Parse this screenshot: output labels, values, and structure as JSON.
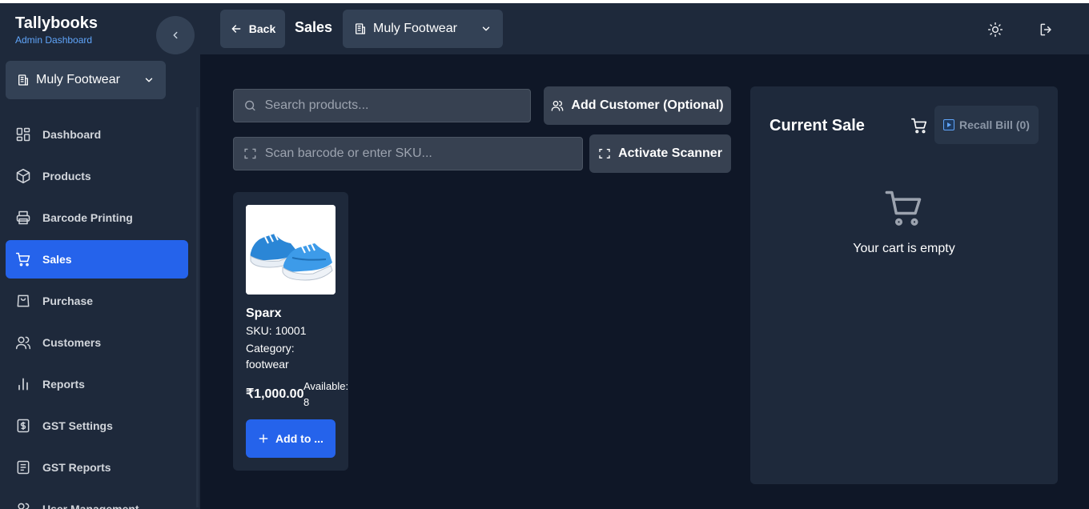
{
  "app": {
    "title": "Tallybooks",
    "subtitle": "Admin Dashboard"
  },
  "sidebar": {
    "store_selector": {
      "value": "Muly Footwear"
    },
    "items": [
      {
        "label": "Dashboard",
        "icon": "dashboard-icon",
        "active": false
      },
      {
        "label": "Products",
        "icon": "box-icon",
        "active": false
      },
      {
        "label": "Barcode Printing",
        "icon": "printer-icon",
        "active": false
      },
      {
        "label": "Sales",
        "icon": "cart-icon",
        "active": true
      },
      {
        "label": "Purchase",
        "icon": "shopping-bag-icon",
        "active": false
      },
      {
        "label": "Customers",
        "icon": "users-icon",
        "active": false
      },
      {
        "label": "Reports",
        "icon": "bar-chart-icon",
        "active": false
      },
      {
        "label": "GST Settings",
        "icon": "receipt-icon",
        "active": false
      },
      {
        "label": "GST Reports",
        "icon": "document-icon",
        "active": false
      },
      {
        "label": "User Management",
        "icon": "user-group-icon",
        "active": false
      }
    ]
  },
  "header": {
    "back_label": "Back",
    "title": "Sales",
    "store_selector": {
      "value": "Muly Footwear"
    }
  },
  "main": {
    "search": {
      "placeholder": "Search products..."
    },
    "add_customer_label": "Add Customer (Optional)",
    "scan": {
      "placeholder": "Scan barcode or enter SKU..."
    },
    "scanner_label": "Activate Scanner",
    "products": [
      {
        "name": "Sparx",
        "sku": "SKU: 10001",
        "category": "Category: footwear",
        "price": "₹1,000.00",
        "available": "Available: 8",
        "add_label": "Add to ..."
      }
    ]
  },
  "sale": {
    "title": "Current Sale",
    "recall_label": "Recall Bill (0)",
    "empty_text": "Your cart is empty"
  },
  "colors": {
    "accent": "#2563eb",
    "background": "#0f1727",
    "panel": "#1e293b",
    "control": "#374151",
    "brand_sub": "#60a5fa"
  }
}
